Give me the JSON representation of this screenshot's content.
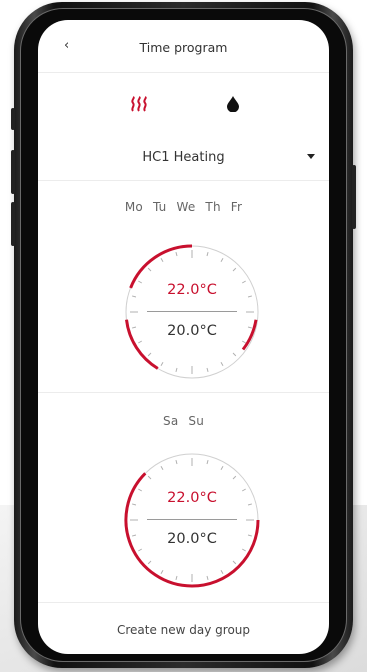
{
  "header": {
    "back_icon": "chevron-left-icon",
    "back_glyph": "‹",
    "title": "Time program"
  },
  "mode_tabs": [
    {
      "name": "heating",
      "icon": "heat-waves-icon",
      "color": "#c8102e",
      "active": true
    },
    {
      "name": "hot-water",
      "icon": "water-drop-icon",
      "color": "#111111",
      "active": false
    }
  ],
  "circuit": {
    "selected": "HC1 Heating",
    "dropdown_icon": "caret-down-icon"
  },
  "day_groups": [
    {
      "days": [
        "Mo",
        "Tu",
        "We",
        "Th",
        "Fr"
      ],
      "comfort_temp": "22.0°C",
      "eco_temp": "20.0°C"
    },
    {
      "days": [
        "Sa",
        "Su"
      ],
      "comfort_temp": "22.0°C",
      "eco_temp": "20.0°C"
    }
  ],
  "footer": {
    "create_label": "Create new day group"
  },
  "colors": {
    "accent": "#c8102e",
    "text": "#333333",
    "muted": "#666666",
    "divider": "#ececec"
  }
}
